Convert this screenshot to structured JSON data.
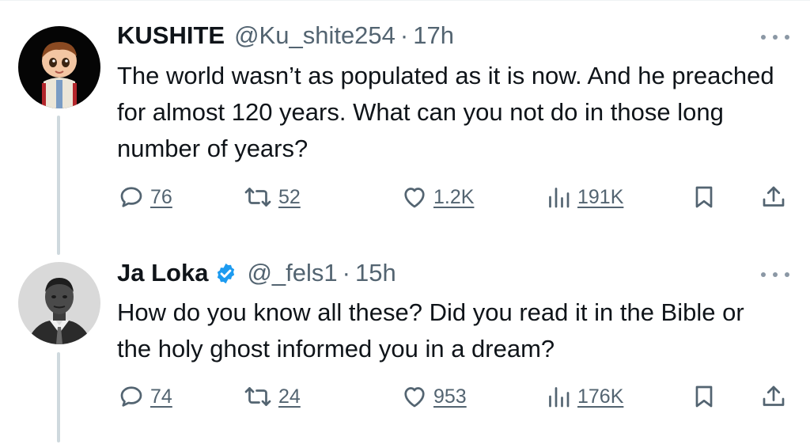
{
  "tweets": [
    {
      "name": "KUSHITE",
      "verified": false,
      "handle": "@Ku_shite254",
      "separator": "·",
      "time": "17h",
      "text": "The world wasn’t as populated as it is now. And he preached for almost 120 years. What can you not do in those long number of years?",
      "replies": "76",
      "retweets": "52",
      "likes": "1.2K",
      "views": "191K",
      "avatar_icon": "cartoon-boy-avatar"
    },
    {
      "name": "Ja Loka",
      "verified": true,
      "handle": "@_fels1",
      "separator": "·",
      "time": "15h",
      "text": "How do you know all these? Did you read it in the Bible or the holy ghost informed you in a dream?",
      "replies": "74",
      "retweets": "24",
      "likes": "953",
      "views": "176K",
      "avatar_icon": "bw-portrait-avatar"
    }
  ],
  "colors": {
    "text": "#0f1419",
    "secondary": "#536471",
    "thread_line": "#cfd9de",
    "verified_blue": "#1d9bf0"
  }
}
